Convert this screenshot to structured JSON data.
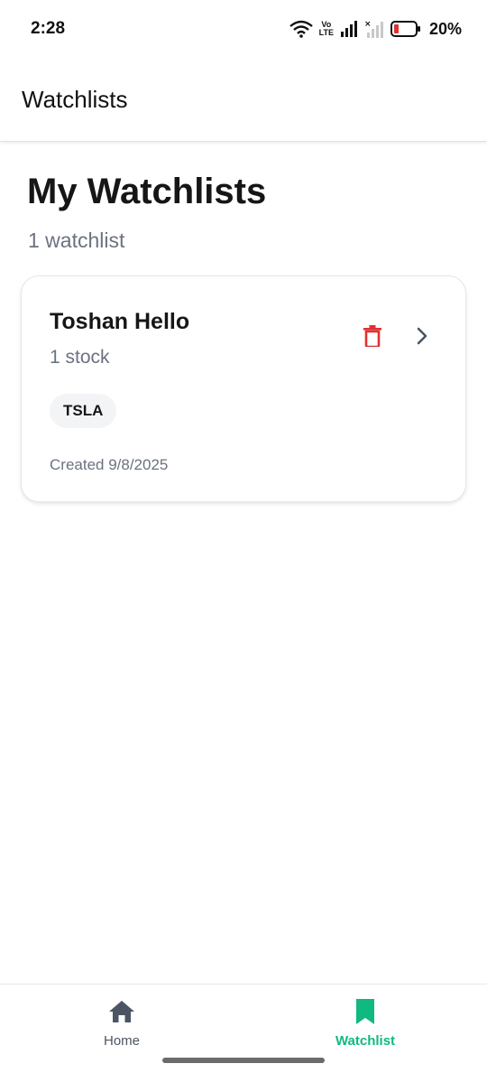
{
  "status_bar": {
    "time": "2:28",
    "volte_line1": "Vo",
    "volte_line2": "LTE",
    "battery": "20%"
  },
  "app_bar": {
    "title": "Watchlists"
  },
  "main": {
    "title": "My Watchlists",
    "subtitle": "1 watchlist",
    "watchlists": [
      {
        "name": "Toshan Hello",
        "count": "1 stock",
        "tickers": [
          "TSLA"
        ],
        "created": "Created 9/8/2025"
      }
    ]
  },
  "bottom_nav": {
    "items": [
      {
        "label": "Home",
        "icon": "home-icon"
      },
      {
        "label": "Watchlist",
        "icon": "bookmark-icon",
        "active": true
      }
    ]
  },
  "colors": {
    "accent": "#10b981",
    "delete": "#e03131",
    "muted": "#6b7280"
  }
}
